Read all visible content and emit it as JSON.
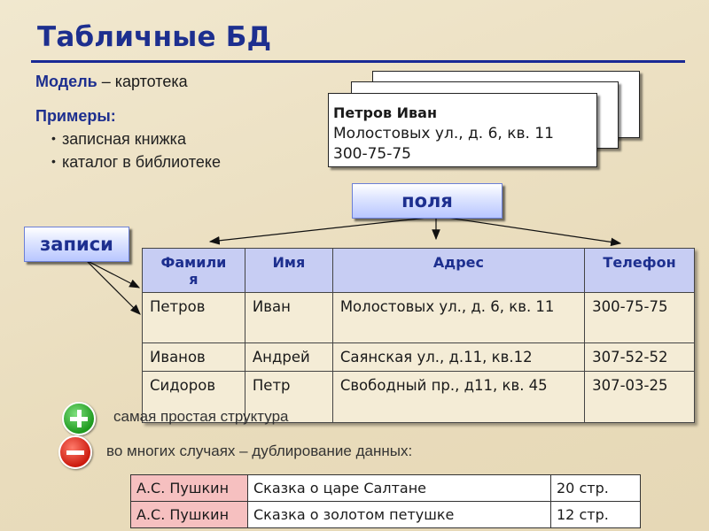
{
  "title": "Табличные БД",
  "model": {
    "label": "Модель",
    "text": "– картотека"
  },
  "examples": {
    "label": "Примеры:",
    "items": [
      "записная книжка",
      "каталог в библиотеке"
    ]
  },
  "card": {
    "name": "Петров Иван",
    "address": "Молостовых ул., д. 6, кв. 11",
    "phone": "300-75-75"
  },
  "fields_label": "поля",
  "records_label": "записи",
  "table": {
    "headers": [
      "Фамилия",
      "Имя",
      "Адрес",
      "Телефон"
    ],
    "header_lines": [
      "Фамили",
      "я"
    ],
    "rows": [
      [
        "Петров",
        "Иван",
        "Молостовых ул., д. 6, кв. 11",
        "300-75-75"
      ],
      [
        "Иванов",
        "Андрей",
        "Саянская ул., д.11, кв.12",
        "307-52-52"
      ],
      [
        "Сидоров",
        "Петр",
        "Свободный пр., д11, кв. 45",
        "307-03-25"
      ]
    ]
  },
  "pros": "самая простая структура",
  "cons": "во многих случаях – дублирование данных:",
  "books": [
    [
      "А.С. Пушкин",
      "Сказка о царе Салтане",
      "20 стр."
    ],
    [
      "А.С. Пушкин",
      "Сказка о золотом петушке",
      "12 стр."
    ]
  ],
  "colors": {
    "title": "#1d2f8f",
    "background": "#ece1c4",
    "header_fill": "#c7cdf3",
    "author_fill": "#f6c0c0",
    "plus": "#1f9a1f",
    "minus": "#cc1b0f"
  },
  "icons": [
    "plus-icon",
    "minus-icon",
    "bullet-icon",
    "arrow-icon"
  ]
}
